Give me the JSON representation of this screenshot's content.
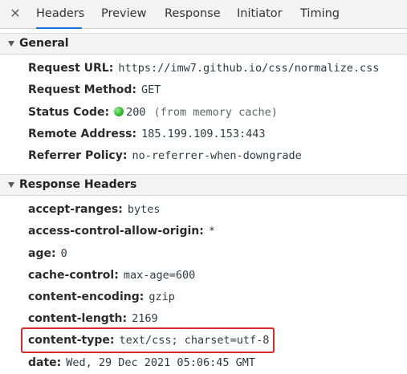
{
  "tabs": {
    "close_icon": "close-icon",
    "items": [
      "Headers",
      "Preview",
      "Response",
      "Initiator",
      "Timing"
    ],
    "active": "Headers",
    "accent_color": "#1a73e8"
  },
  "general": {
    "title": "General",
    "request_url": {
      "key": "Request URL:",
      "value": "https://imw7.github.io/css/normalize.css"
    },
    "request_method": {
      "key": "Request Method:",
      "value": "GET"
    },
    "status_code": {
      "key": "Status Code:",
      "value": "200",
      "extra": "(from memory cache)",
      "status_color": "#2fbf2f"
    },
    "remote_address": {
      "key": "Remote Address:",
      "value": "185.199.109.153:443"
    },
    "referrer_policy": {
      "key": "Referrer Policy:",
      "value": "no-referrer-when-downgrade"
    }
  },
  "response_headers": {
    "title": "Response Headers",
    "items": [
      {
        "key": "accept-ranges:",
        "value": "bytes"
      },
      {
        "key": "access-control-allow-origin:",
        "value": "*"
      },
      {
        "key": "age:",
        "value": "0"
      },
      {
        "key": "cache-control:",
        "value": "max-age=600"
      },
      {
        "key": "content-encoding:",
        "value": "gzip"
      },
      {
        "key": "content-length:",
        "value": "2169"
      },
      {
        "key": "content-type:",
        "value": "text/css; charset=utf-8"
      },
      {
        "key": "date:",
        "value": "Wed, 29 Dec 2021 05:06:45 GMT"
      }
    ],
    "highlight_color": "#d42b2b"
  }
}
